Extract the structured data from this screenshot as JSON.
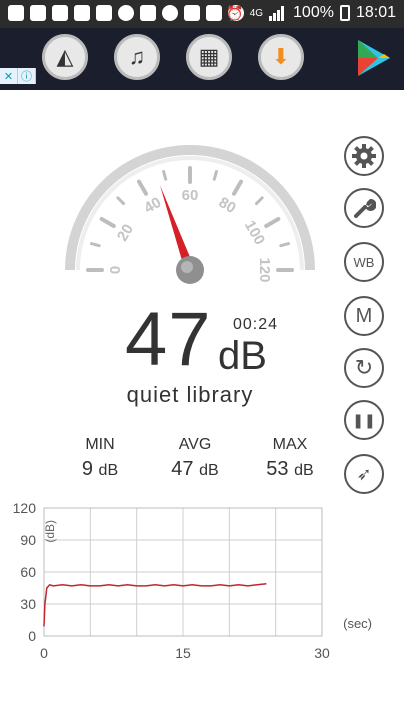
{
  "status_bar": {
    "network": "4G",
    "battery": "100%",
    "time": "18:01"
  },
  "ad": {
    "info_icon": "info-icon",
    "tiles": [
      "speedometer-icon",
      "music-note-icon",
      "film-icon",
      "download-icon"
    ],
    "store_icon": "play-store-icon"
  },
  "gauge": {
    "ticks": [
      "0",
      "20",
      "40",
      "60",
      "80",
      "100",
      "120"
    ],
    "min": 0,
    "max": 120,
    "needle_value": 47
  },
  "reading": {
    "value": "47",
    "unit": "dB",
    "elapsed": "00:24",
    "description": "quiet library"
  },
  "stats": [
    {
      "label": "MIN",
      "value": "9",
      "unit": "dB"
    },
    {
      "label": "AVG",
      "value": "47",
      "unit": "dB"
    },
    {
      "label": "MAX",
      "value": "53",
      "unit": "dB"
    }
  ],
  "side_buttons": [
    {
      "name": "settings-button",
      "icon": "gear-icon",
      "glyph": ""
    },
    {
      "name": "calibration-button",
      "icon": "wrench-icon",
      "glyph": ""
    },
    {
      "name": "weighting-button",
      "icon": "wb-icon",
      "glyph": "WB"
    },
    {
      "name": "mode-button",
      "icon": "m-icon",
      "glyph": "M"
    },
    {
      "name": "reset-button",
      "icon": "reset-icon",
      "glyph": "↻"
    },
    {
      "name": "pause-button",
      "icon": "pause-icon",
      "glyph": "❚❚"
    },
    {
      "name": "compass-button",
      "icon": "compass-icon",
      "glyph": "➶"
    }
  ],
  "chart_data": {
    "type": "line",
    "ylabel": "(dB)",
    "xlabel": "(sec)",
    "yticks": [
      "120",
      "90",
      "60",
      "30",
      "0"
    ],
    "xticks": [
      "0",
      "15",
      "30"
    ],
    "xlim": [
      0,
      30
    ],
    "ylim": [
      0,
      120
    ],
    "series": [
      {
        "color": "#c0262d",
        "x": [
          0,
          0.1,
          0.3,
          0.6,
          1,
          2,
          3,
          4,
          5,
          6,
          7,
          8,
          9,
          10,
          11,
          12,
          13,
          14,
          15,
          16,
          17,
          18,
          19,
          20,
          21,
          22,
          23,
          24
        ],
        "values": [
          9,
          30,
          45,
          48,
          47,
          48,
          47,
          48,
          47,
          47,
          48,
          47,
          48,
          47,
          47,
          48,
          47,
          48,
          47,
          48,
          47,
          47,
          48,
          47,
          48,
          47,
          48,
          49
        ]
      }
    ]
  }
}
